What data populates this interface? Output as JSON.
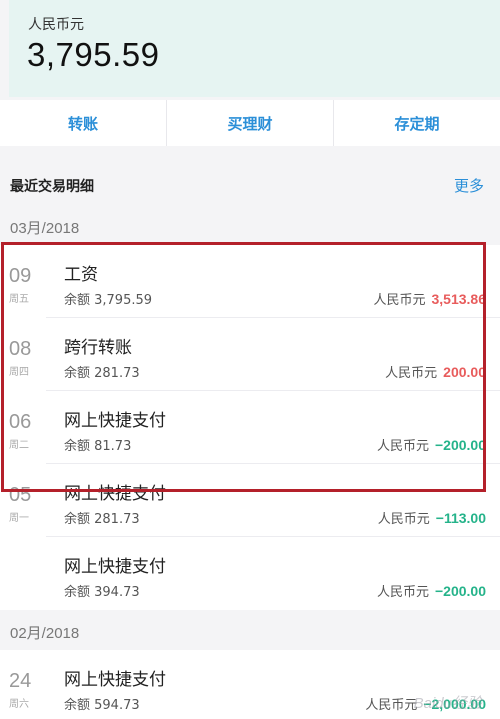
{
  "account": {
    "currency_label": "人民币元",
    "balance": "3,795.59"
  },
  "actions": [
    {
      "label": "转账"
    },
    {
      "label": "买理财"
    },
    {
      "label": "存定期"
    }
  ],
  "recent": {
    "title": "最近交易明细",
    "more_label": "更多"
  },
  "months": [
    {
      "label": "03月/2018",
      "transactions": [
        {
          "day": "09",
          "weekday": "周五",
          "name": "工资",
          "balance": "余额 3,795.59",
          "currency": "人民币元",
          "amount": "3,513.86",
          "direction": "in"
        },
        {
          "day": "08",
          "weekday": "周四",
          "name": "跨行转账",
          "balance": "余额 281.73",
          "currency": "人民币元",
          "amount": "200.00",
          "direction": "in"
        },
        {
          "day": "06",
          "weekday": "周二",
          "name": "网上快捷支付",
          "balance": "余额 81.73",
          "currency": "人民币元",
          "amount": "−200.00",
          "direction": "out"
        },
        {
          "day": "05",
          "weekday": "周一",
          "name": "网上快捷支付",
          "balance": "余额 281.73",
          "currency": "人民币元",
          "amount": "−113.00",
          "direction": "out"
        },
        {
          "day": "",
          "weekday": "",
          "name": "网上快捷支付",
          "balance": "余额 394.73",
          "currency": "人民币元",
          "amount": "−200.00",
          "direction": "out"
        }
      ]
    },
    {
      "label": "02月/2018",
      "transactions": [
        {
          "day": "24",
          "weekday": "周六",
          "name": "网上快捷支付",
          "balance": "余额 594.73",
          "currency": "人民币元",
          "amount": "−2,000.00",
          "direction": "out"
        }
      ]
    }
  ],
  "watermark": "Baidu经验",
  "colors": {
    "accent": "#2b8fd8",
    "income": "#e85c5c",
    "expense": "#25b38a",
    "highlight": "#b4202a"
  }
}
